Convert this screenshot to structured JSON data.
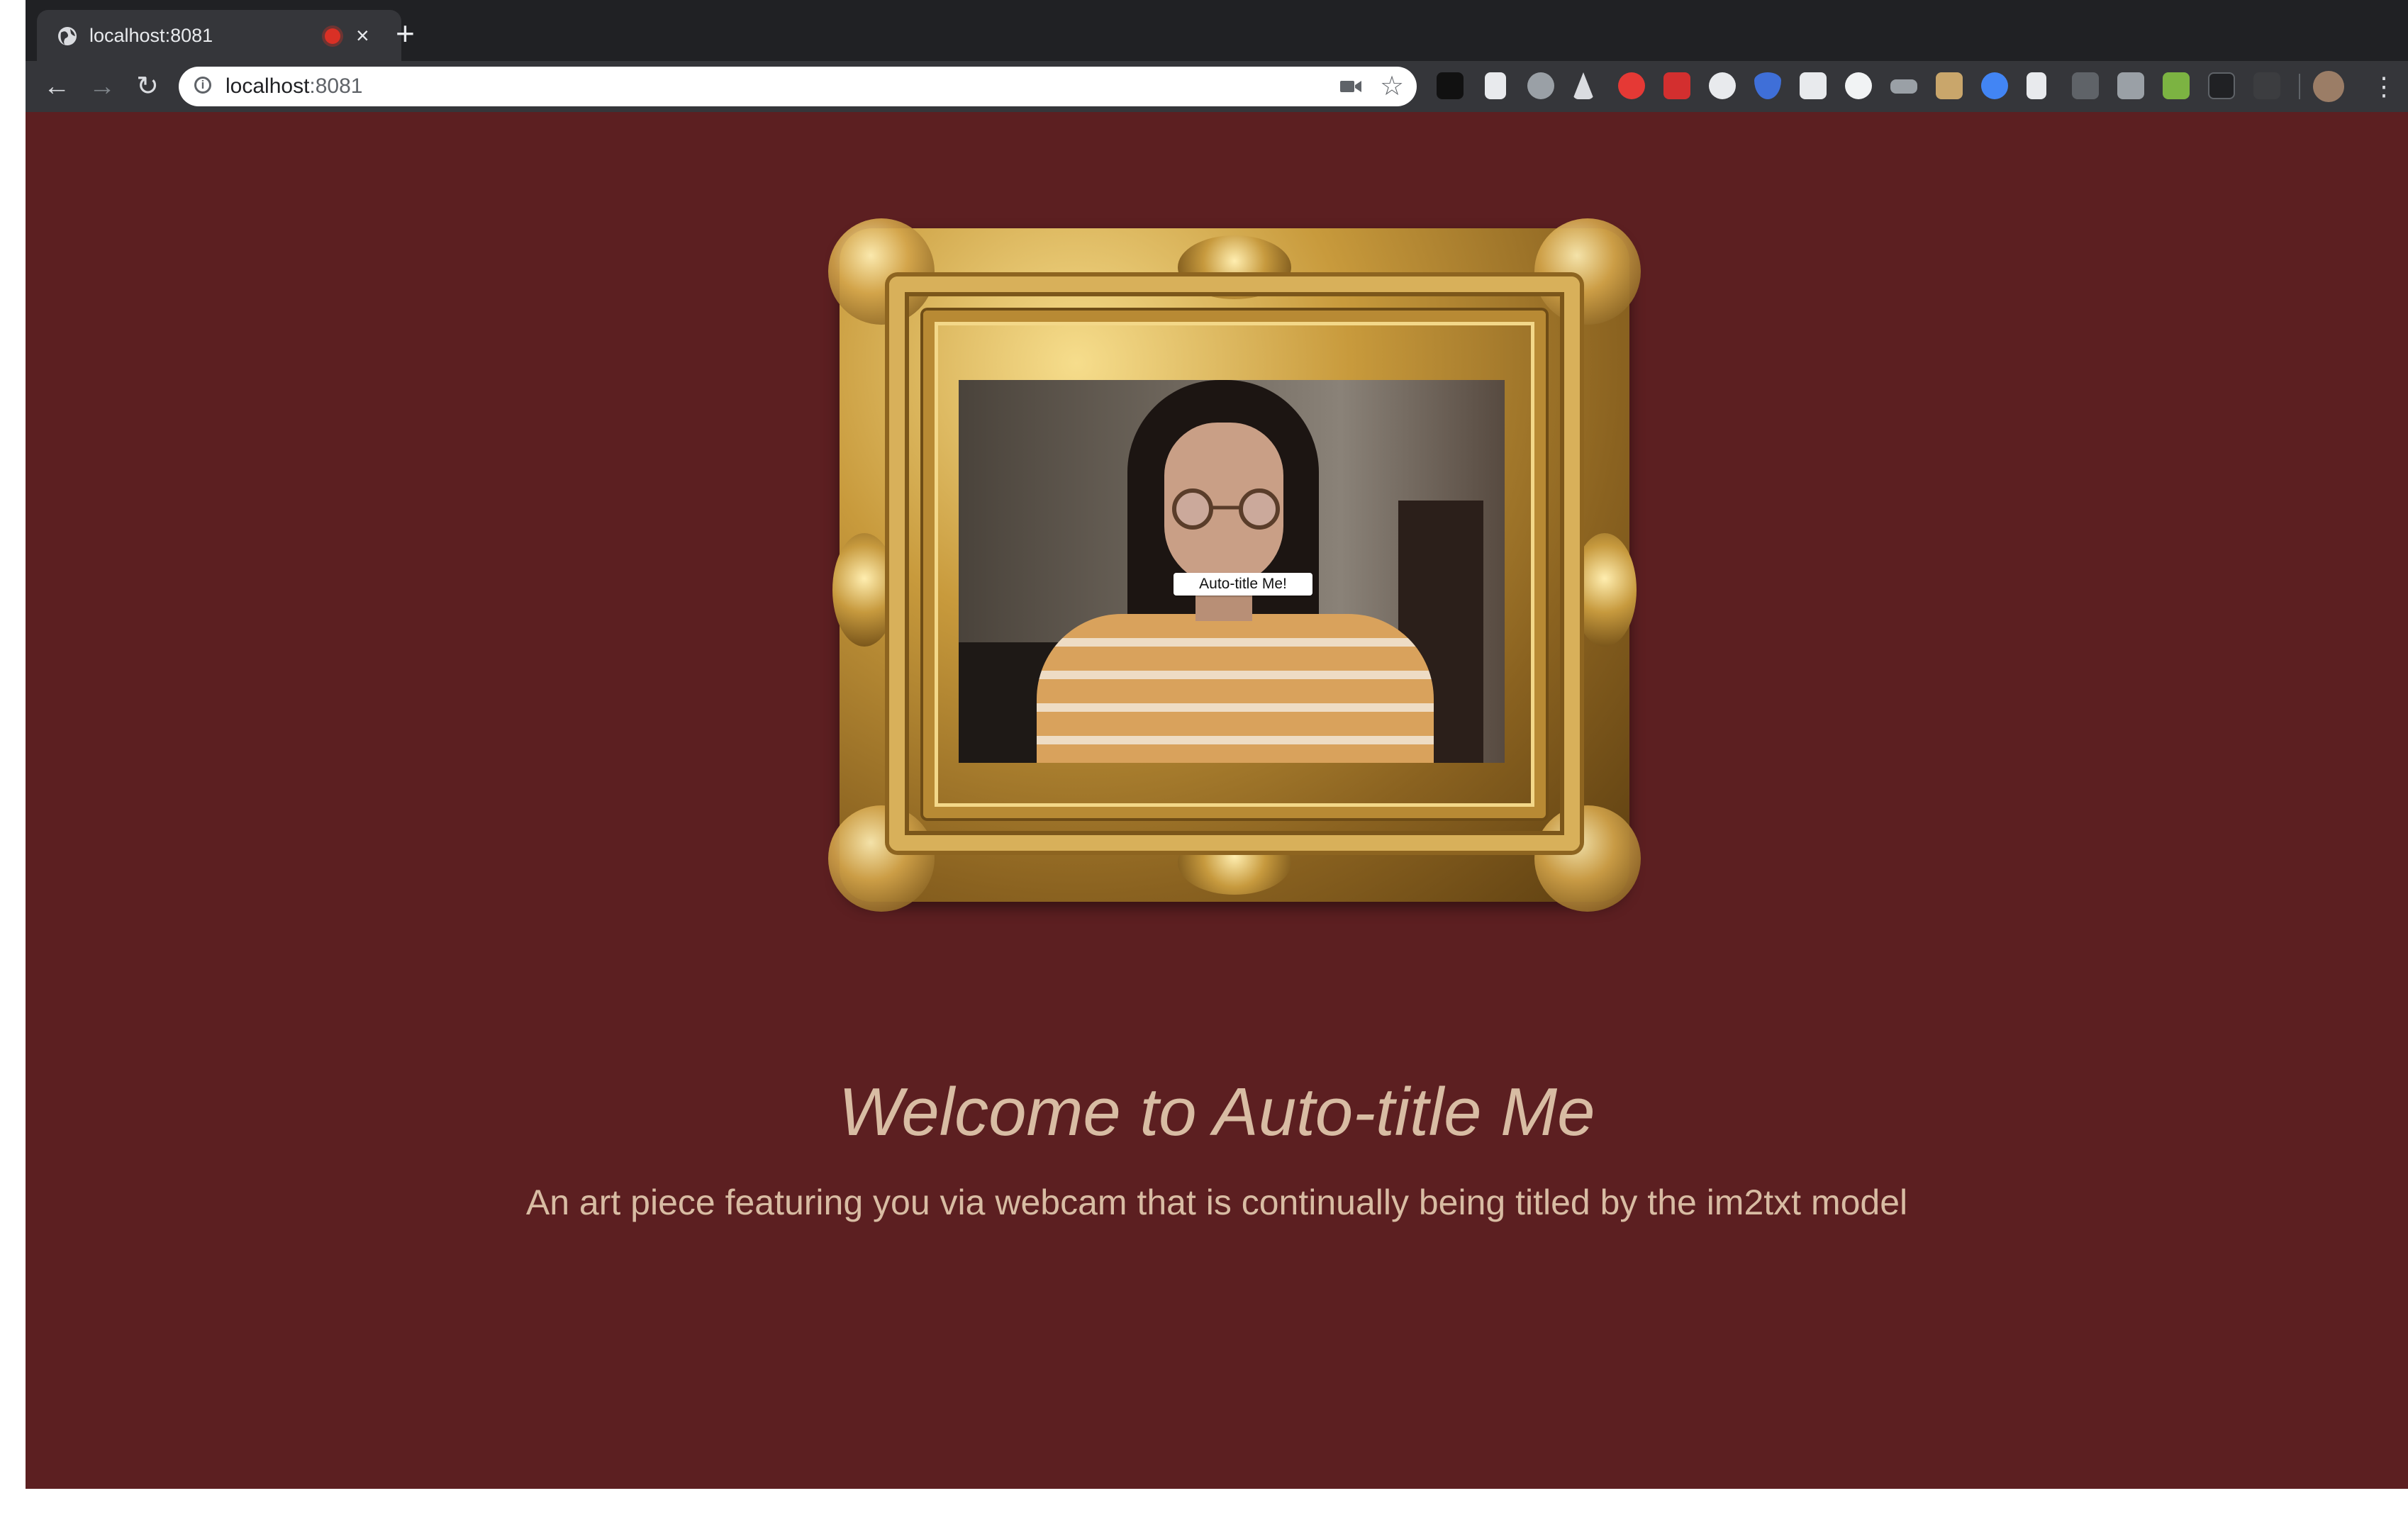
{
  "browser": {
    "tab_title": "localhost:8081",
    "url_host": "localhost",
    "url_port": ":8081",
    "tab_close_glyph": "×",
    "new_tab_glyph": "+",
    "back_glyph": "←",
    "forward_glyph": "→",
    "reload_glyph": "↻",
    "star_glyph": "☆",
    "menu_glyph": "⋮",
    "info_glyph": "i",
    "icons": [
      "globe-icon",
      "recording-icon",
      "camera-icon",
      "star-icon",
      "extension-icons",
      "avatar",
      "menu-icon"
    ]
  },
  "page": {
    "frame_button_label": "Auto-title Me!",
    "headline": "Welcome to Auto-title Me",
    "subline": "An art piece featuring you via webcam that is continually being titled by the im2txt model"
  },
  "colors": {
    "background": "#5c1f21",
    "text": "#d8bca3",
    "frame_gold": "#c89a3c",
    "chrome_dark": "#202124",
    "chrome_toolbar": "#35363a"
  }
}
